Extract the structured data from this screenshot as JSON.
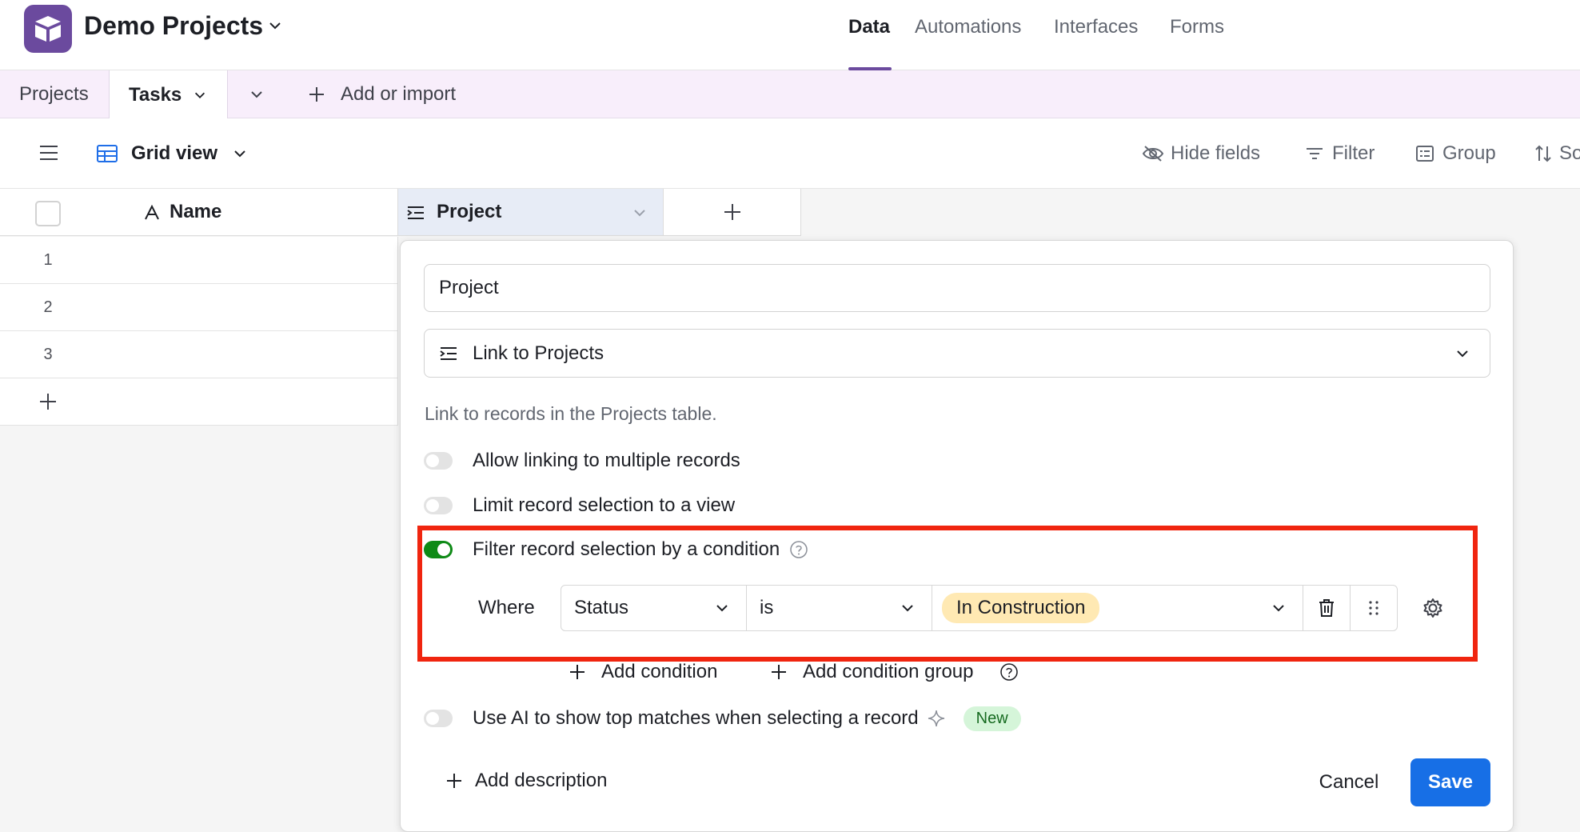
{
  "header": {
    "base_name": "Demo Projects",
    "nav": [
      "Data",
      "Automations",
      "Interfaces",
      "Forms"
    ],
    "active_nav": "Data"
  },
  "tabs": {
    "items": [
      "Projects",
      "Tasks"
    ],
    "active": "Tasks",
    "add_label": "Add or import"
  },
  "viewbar": {
    "view_name": "Grid view",
    "hide_fields": "Hide fields",
    "filter": "Filter",
    "group": "Group",
    "sort_partial": "So"
  },
  "grid": {
    "col_name": "Name",
    "col_project": "Project",
    "rows": [
      "1",
      "2",
      "3"
    ]
  },
  "field_editor": {
    "field_name": "Project",
    "field_type": "Link to Projects",
    "description": "Link to records in the Projects table.",
    "options": [
      {
        "label": "Allow linking to multiple records",
        "enabled": false
      },
      {
        "label": "Limit record selection to a view",
        "enabled": false
      },
      {
        "label": "Filter record selection by a condition",
        "enabled": true
      }
    ],
    "condition": {
      "where": "Where",
      "field": "Status",
      "operator": "is",
      "value": "In Construction"
    },
    "add_condition": "Add condition",
    "add_condition_group": "Add condition group",
    "ai_option": {
      "label": "Use AI to show top matches when selecting a record",
      "enabled": false,
      "badge": "New"
    },
    "add_description": "Add description",
    "cancel": "Cancel",
    "save": "Save"
  },
  "colors": {
    "accent": "#6b4a9e",
    "save": "#176fe6",
    "toggle_on": "#0e8a16",
    "highlight": "#f0250f",
    "pill": "#ffe9b3"
  }
}
